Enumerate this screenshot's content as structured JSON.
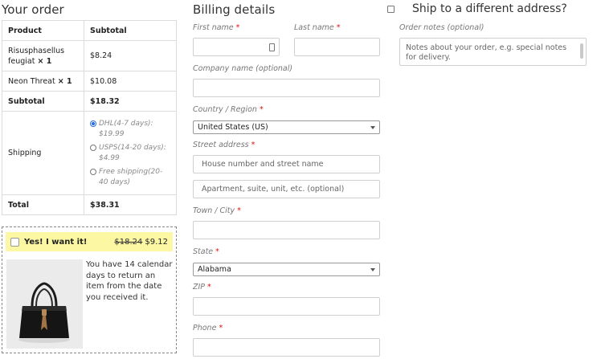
{
  "order": {
    "title": "Your order",
    "headers": {
      "product": "Product",
      "subtotal": "Subtotal"
    },
    "items": [
      {
        "name": "Risusphasellus feugiat",
        "qty": "× 1",
        "price": "$8.24"
      },
      {
        "name": "Neon Threat",
        "qty": "× 1",
        "price": "$10.08"
      }
    ],
    "subtotal": {
      "label": "Subtotal",
      "value": "$18.32"
    },
    "shipping": {
      "label": "Shipping",
      "options": [
        {
          "text": "DHL(4-7 days): $19.99",
          "selected": true
        },
        {
          "text": "USPS(14-20 days): $4.99",
          "selected": false
        },
        {
          "text": "Free shipping(20-40 days)",
          "selected": false
        }
      ]
    },
    "total": {
      "label": "Total",
      "value": "$38.31"
    }
  },
  "upsell": {
    "label": "Yes! I want it!",
    "old_price": "$18.24",
    "new_price": "$9.12",
    "description": "You have 14 calendar days to return an item from the date you received it."
  },
  "billing": {
    "title": "Billing details",
    "first_name": {
      "label": "First name",
      "required": "*",
      "value": ""
    },
    "last_name": {
      "label": "Last name",
      "required": "*",
      "value": ""
    },
    "company": {
      "label": "Company name (optional)",
      "value": ""
    },
    "country": {
      "label": "Country / Region",
      "required": "*",
      "value": "United States (US)"
    },
    "street": {
      "label": "Street address",
      "required": "*",
      "placeholder1": "House number and street name",
      "placeholder2": "Apartment, suite, unit, etc. (optional)"
    },
    "city": {
      "label": "Town / City",
      "required": "*",
      "value": ""
    },
    "state": {
      "label": "State",
      "required": "*",
      "value": "Alabama"
    },
    "zip": {
      "label": "ZIP",
      "required": "*",
      "value": ""
    },
    "phone": {
      "label": "Phone",
      "required": "*",
      "value": ""
    }
  },
  "shipping_alt": {
    "label": "Ship to a different address?",
    "checked": false
  },
  "notes": {
    "label": "Order notes (optional)",
    "placeholder": "Notes about your order, e.g. special notes for delivery."
  },
  "colors": {
    "required": "#dd1111",
    "upsell_bg": "#fbf7a3",
    "radio": "#2a6be0"
  }
}
